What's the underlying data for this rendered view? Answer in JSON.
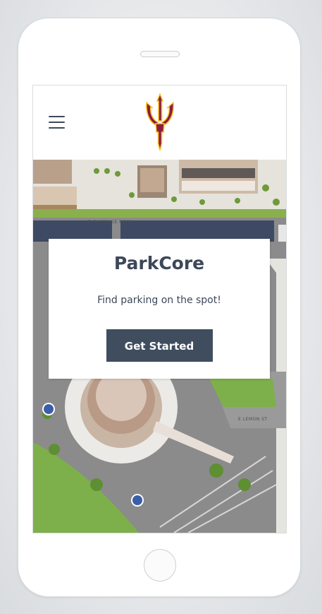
{
  "app": {
    "title": "ParkCore",
    "tagline": "Find parking on the spot!",
    "cta_label": "Get Started"
  },
  "header": {
    "menu_icon": "hamburger-menu-icon",
    "logo_icon": "pitchfork-logo-icon"
  },
  "map": {
    "street_labels": [
      "E GAMMAGE PKWY",
      "E LEMON ST"
    ]
  },
  "colors": {
    "primary": "#3f4d5f",
    "title_text": "#3c4858",
    "logo_maroon": "#8c1d40",
    "logo_gold": "#ffc627"
  }
}
